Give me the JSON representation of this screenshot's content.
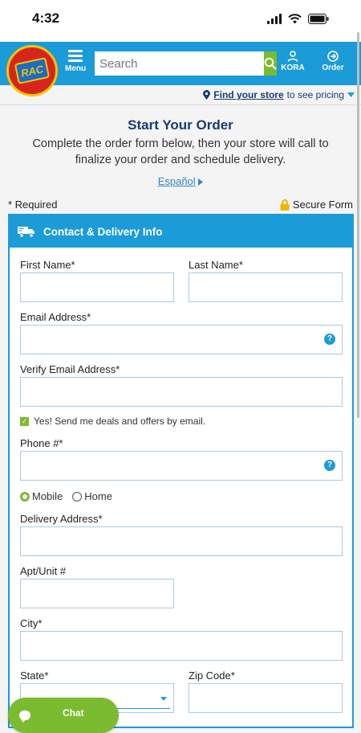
{
  "status_bar": {
    "time": "4:32"
  },
  "header": {
    "logo_text": "RAC",
    "menu_label": "Menu",
    "search_placeholder": "Search",
    "kora_label": "KORA",
    "order_label": "Order",
    "brand_color": "#1b9bd8",
    "accent_color": "#7bbb2f"
  },
  "store_bar": {
    "link_text": "Find your store",
    "suffix": "to see pricing"
  },
  "intro": {
    "title": "Start Your Order",
    "description": "Complete the order form below, then your store will call to finalize your order and schedule delivery.",
    "language_link": "Español"
  },
  "form_meta": {
    "required_note": "* Required",
    "secure_label": "Secure Form"
  },
  "form": {
    "section_title": "Contact & Delivery Info",
    "first_name_label": "First Name*",
    "last_name_label": "Last Name*",
    "email_label": "Email Address*",
    "verify_email_label": "Verify Email Address*",
    "deals_checkbox_label": "Yes! Send me deals and offers by email.",
    "deals_checked": true,
    "phone_label": "Phone #*",
    "phone_type_mobile": "Mobile",
    "phone_type_home": "Home",
    "phone_type_selected": "Mobile",
    "delivery_address_label": "Delivery Address*",
    "apt_label": "Apt/Unit #",
    "city_label": "City*",
    "state_label": "State*",
    "zip_label": "Zip Code*",
    "help_glyph": "?"
  },
  "chat": {
    "label": "Chat"
  }
}
